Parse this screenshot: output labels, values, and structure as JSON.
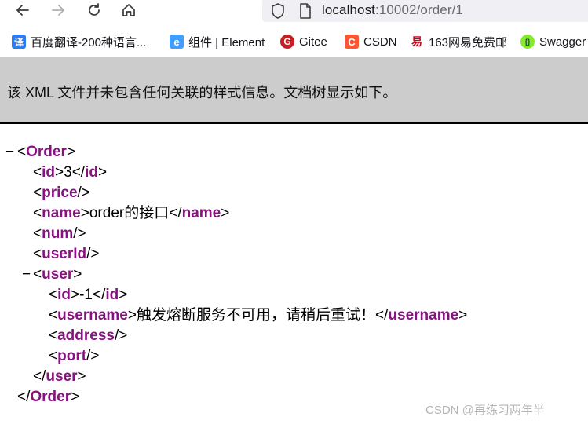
{
  "browser": {
    "url_host": "localhost",
    "url_rest": ":10002/order/1"
  },
  "bookmarks": [
    {
      "label": "百度翻译-200种语言...",
      "icon": "baidu-translate-icon",
      "glyph": "译",
      "color": "#2b7cf6"
    },
    {
      "label": "组件 | Element",
      "icon": "element-icon",
      "glyph": "e",
      "color": "#409eff"
    },
    {
      "label": "Gitee",
      "icon": "gitee-icon",
      "glyph": "G",
      "color": "#c71d23"
    },
    {
      "label": "CSDN",
      "icon": "csdn-icon",
      "glyph": "C",
      "color": "#fc5531"
    },
    {
      "label": "163网易免费邮",
      "icon": "netease-163-icon",
      "glyph": "易",
      "color": "#d0021b"
    },
    {
      "label": "Swagger",
      "icon": "swagger-icon",
      "glyph": "{}",
      "color": "#85ea2d"
    }
  ],
  "banner": {
    "message": "该 XML 文件并未包含任何关联的样式信息。文档树显示如下。"
  },
  "xml": {
    "order_open": "Order",
    "id_tag": "id",
    "id_value": "3",
    "price_tag": "price",
    "name_tag": "name",
    "name_value": "order的接口",
    "num_tag": "num",
    "userid_tag": "userId",
    "user_tag": "user",
    "user_id_tag": "id",
    "user_id_value": "-1",
    "username_tag": "username",
    "username_value": "触发熔断服务不可用，请稍后重试！",
    "address_tag": "address",
    "port_tag": "port",
    "collapse_glyph": "−"
  },
  "watermark": "CSDN @再练习两年半",
  "colors": {
    "tag": "#881280",
    "banner_bg": "#cccccc"
  }
}
